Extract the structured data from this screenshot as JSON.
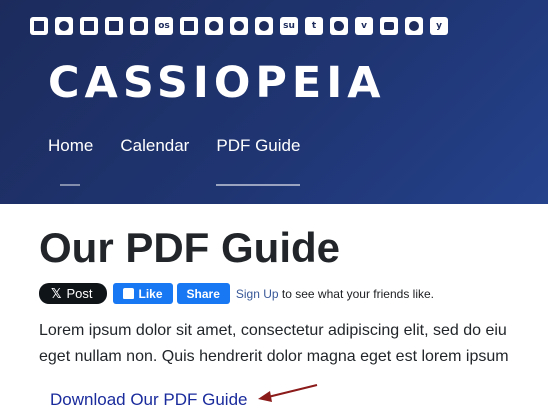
{
  "social_icons": [
    "mail-icon",
    "dribbble-icon",
    "facebook-icon",
    "flickr-icon",
    "instagram-icon",
    "lastfm-icon",
    "linkedin-icon",
    "mix-icon",
    "reddit-icon",
    "pinterest-icon",
    "stumbleupon-icon",
    "tumblr-icon",
    "twitter-icon",
    "vimeo-icon",
    "youtube-icon",
    "whatsapp-icon",
    "yelp-icon"
  ],
  "site": {
    "brand": "CASSIOPEIA"
  },
  "nav": {
    "items": [
      {
        "label": "Home"
      },
      {
        "label": "Calendar"
      },
      {
        "label": "PDF Guide"
      }
    ]
  },
  "main": {
    "title": "Our PDF Guide",
    "share": {
      "x_label": "Post",
      "fb_like": "Like",
      "fb_share": "Share",
      "signup_link": "Sign Up",
      "signup_rest": " to see what your friends like."
    },
    "paragraph_line1": "Lorem ipsum dolor sit amet, consectetur adipiscing elit, sed do eiu",
    "paragraph_line2": "eget nullam non. Quis hendrerit dolor magna eget est lorem ipsum",
    "download_link": "Download Our PDF Guide"
  },
  "colors": {
    "header_bg": "#1f3572",
    "link": "#1a2b9c",
    "annotation_arrow": "#8b1a1a",
    "fb_blue": "#1877f2"
  }
}
